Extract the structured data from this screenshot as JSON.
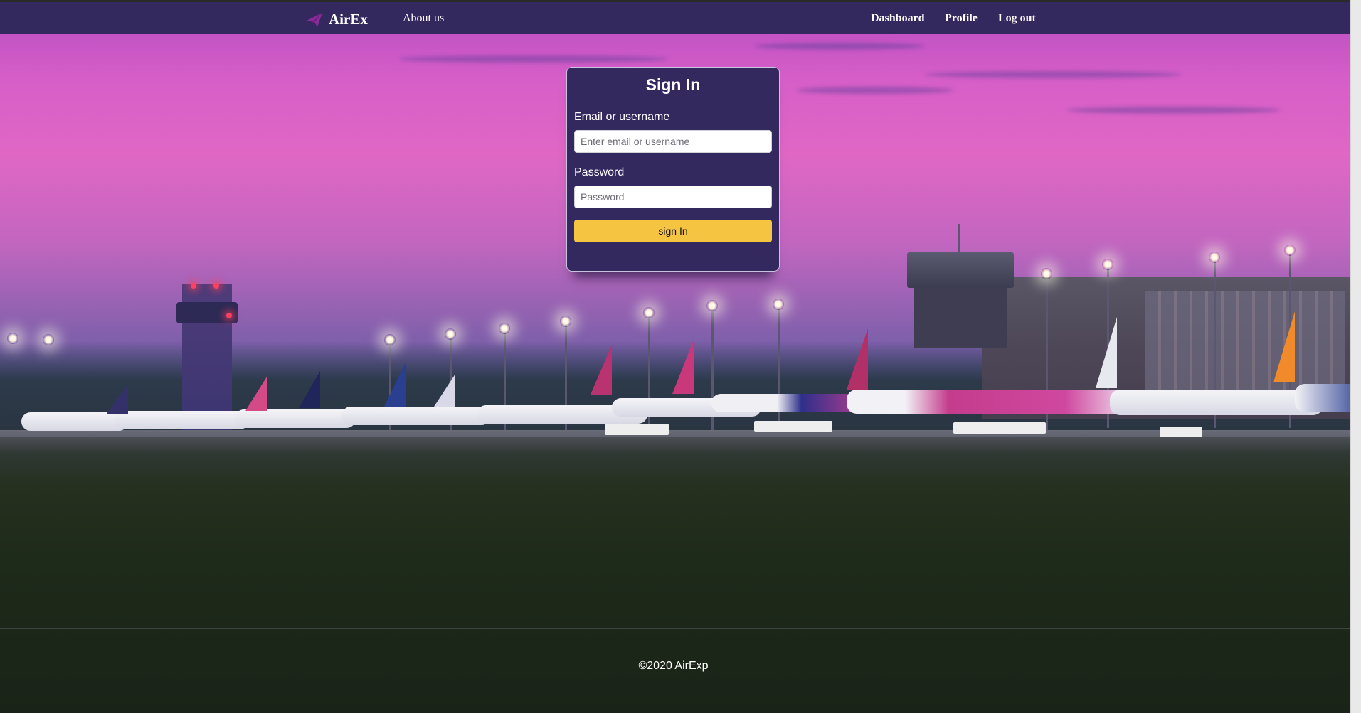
{
  "nav": {
    "brand": "AirEx",
    "brand_icon": "plane-icon",
    "about": "About us",
    "dashboard": "Dashboard",
    "profile": "Profile",
    "logout": "Log out",
    "bar_color": "#33295f"
  },
  "signin": {
    "title": "Sign In",
    "email_label": "Email or username",
    "email_placeholder": "Enter email or username",
    "email_value": "",
    "password_label": "Password",
    "password_placeholder": "Password",
    "password_value": "",
    "submit_label": "sign In",
    "button_color": "#f5c542"
  },
  "footer": {
    "copyright": "©2020 AirExp"
  }
}
